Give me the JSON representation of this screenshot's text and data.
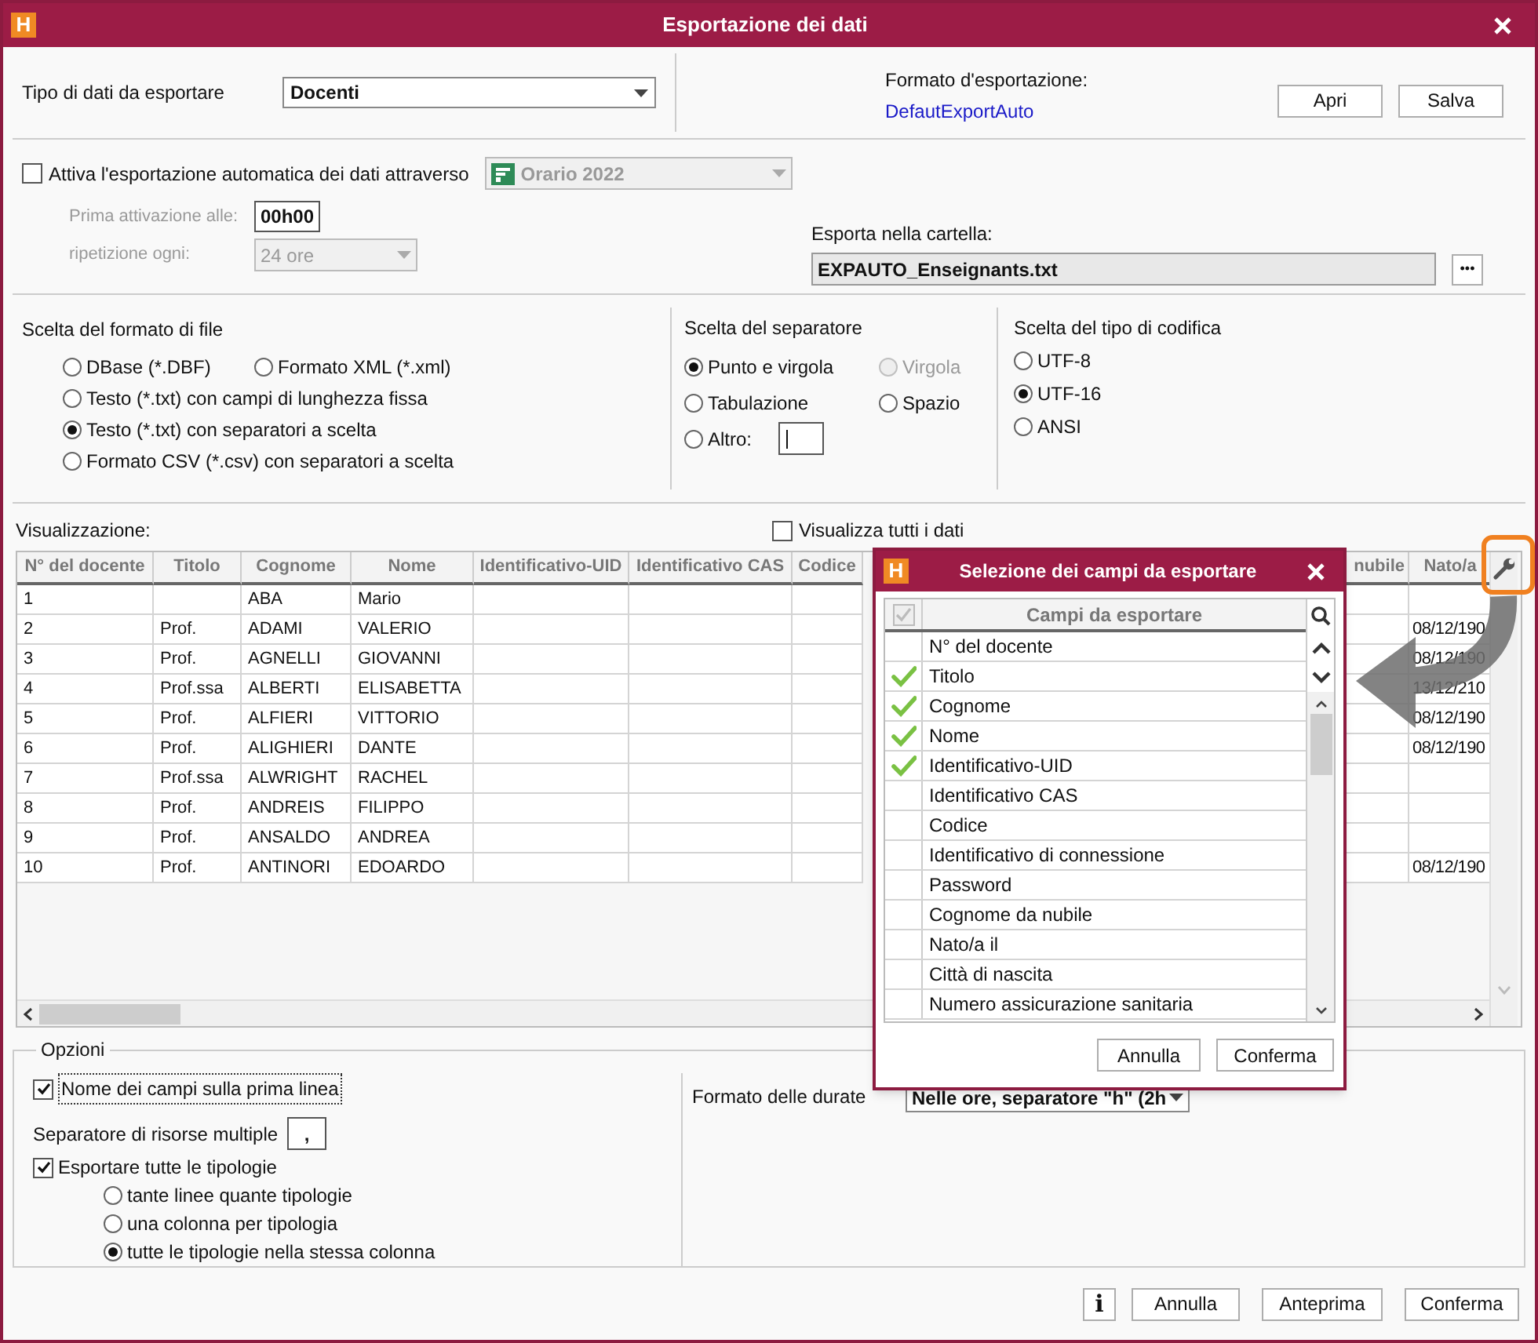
{
  "window": {
    "logo": "H",
    "title": "Esportazione dei dati"
  },
  "export_type": {
    "label": "Tipo di dati da esportare",
    "value": "Docenti"
  },
  "export_format": {
    "label": "Formato d'esportazione:",
    "link": "DefautExportAuto",
    "buttons": [
      "Apri",
      "Salva"
    ]
  },
  "auto_export": {
    "label": "Attiva l'esportazione automatica dei dati attraverso",
    "checked": false,
    "source": "Orario 2022",
    "first_activation": {
      "label": "Prima attivazione alle:",
      "value": "00h00"
    },
    "repeat": {
      "label": "ripetizione ogni:",
      "value": "24 ore"
    },
    "folder": {
      "label": "Esporta nella cartella:",
      "value": "EXPAUTO_Enseignants.txt",
      "browse": "•••"
    }
  },
  "file_format": {
    "title": "Scelta del formato di file",
    "options": [
      {
        "label": "DBase (*.DBF)",
        "selected": false
      },
      {
        "label": "Formato XML (*.xml)",
        "selected": false
      },
      {
        "label": "Testo (*.txt) con campi di lunghezza fissa",
        "selected": false
      },
      {
        "label": "Testo (*.txt) con separatori a scelta",
        "selected": true
      },
      {
        "label": "Formato CSV (*.csv) con separatori a scelta",
        "selected": false
      }
    ]
  },
  "separator": {
    "title": "Scelta del separatore",
    "options": [
      {
        "label": "Punto e virgola",
        "selected": true,
        "disabled": false
      },
      {
        "label": "Virgola",
        "selected": false,
        "disabled": true
      },
      {
        "label": "Tabulazione",
        "selected": false,
        "disabled": false
      },
      {
        "label": "Spazio",
        "selected": false,
        "disabled": false
      },
      {
        "label": "Altro:",
        "selected": false,
        "disabled": false
      }
    ]
  },
  "encoding": {
    "title": "Scelta del tipo di codifica",
    "options": [
      {
        "label": "UTF-8",
        "selected": false
      },
      {
        "label": "UTF-16",
        "selected": true
      },
      {
        "label": "ANSI",
        "selected": false
      }
    ]
  },
  "preview": {
    "label": "Visualizzazione:",
    "show_all": {
      "label": "Visualizza tutti i dati",
      "checked": false
    },
    "table": {
      "columns": [
        "N° del docente",
        "Titolo",
        "Cognome",
        "Nome",
        "Identificativo-UID",
        "Identificativo CAS",
        "Codice",
        "nubile",
        "Nato/a"
      ],
      "rows": [
        [
          "1",
          "",
          "ABA",
          "Mario",
          "",
          "",
          "",
          "",
          ""
        ],
        [
          "2",
          "Prof.",
          "ADAMI",
          "VALERIO",
          "",
          "",
          "",
          "",
          "08/12/190"
        ],
        [
          "3",
          "Prof.",
          "AGNELLI",
          "GIOVANNI",
          "",
          "",
          "",
          "",
          "08/12/190"
        ],
        [
          "4",
          "Prof.ssa",
          "ALBERTI",
          "ELISABETTA",
          "",
          "",
          "",
          "",
          "13/12/210"
        ],
        [
          "5",
          "Prof.",
          "ALFIERI",
          "VITTORIO",
          "",
          "",
          "",
          "",
          "08/12/190"
        ],
        [
          "6",
          "Prof.",
          "ALIGHIERI",
          "DANTE",
          "",
          "",
          "",
          "",
          "08/12/190"
        ],
        [
          "7",
          "Prof.ssa",
          "ALWRIGHT",
          "RACHEL",
          "",
          "",
          "",
          "",
          ""
        ],
        [
          "8",
          "Prof.",
          "ANDREIS",
          "FILIPPO",
          "",
          "",
          "",
          "",
          ""
        ],
        [
          "9",
          "Prof.",
          "ANSALDO",
          "ANDREA",
          "",
          "",
          "",
          "",
          ""
        ],
        [
          "10",
          "Prof.",
          "ANTINORI",
          "EDOARDO",
          "",
          "",
          "",
          "",
          "08/12/190"
        ]
      ]
    }
  },
  "fields_dialog": {
    "logo": "H",
    "title": "Selezione dei campi da esportare",
    "header": "Campi da esportare",
    "select_all": {
      "checked": true,
      "disabled": true
    },
    "items": [
      {
        "label": "N° del docente",
        "checked": false
      },
      {
        "label": "Titolo",
        "checked": true
      },
      {
        "label": "Cognome",
        "checked": true
      },
      {
        "label": "Nome",
        "checked": true
      },
      {
        "label": "Identificativo-UID",
        "checked": true
      },
      {
        "label": "Identificativo CAS",
        "checked": false
      },
      {
        "label": "Codice",
        "checked": false
      },
      {
        "label": "Identificativo di connessione",
        "checked": false
      },
      {
        "label": "Password",
        "checked": false
      },
      {
        "label": "Cognome da nubile",
        "checked": false
      },
      {
        "label": "Nato/a il",
        "checked": false
      },
      {
        "label": "Città di nascita",
        "checked": false
      },
      {
        "label": "Numero assicurazione sanitaria",
        "checked": false
      }
    ],
    "buttons": [
      "Annulla",
      "Conferma"
    ]
  },
  "options": {
    "title": "Opzioni",
    "field_names_first_line": {
      "label": "Nome dei campi sulla prima linea",
      "checked": true
    },
    "multi_separator": {
      "label": "Separatore di risorse multiple",
      "value": ","
    },
    "export_all_types": {
      "label": "Esportare tutte le tipologie",
      "checked": true,
      "modes": [
        {
          "label": "tante linee quante tipologie",
          "selected": false
        },
        {
          "label": "una colonna per tipologia",
          "selected": false
        },
        {
          "label": "tutte le tipologie nella stessa colonna",
          "selected": true
        }
      ]
    },
    "duration_format": {
      "label": "Formato delle durate",
      "value": "Nelle ore, separatore \"h\" (2h"
    }
  },
  "footer": {
    "info": "i",
    "buttons": [
      "Annulla",
      "Anteprima",
      "Conferma"
    ]
  }
}
